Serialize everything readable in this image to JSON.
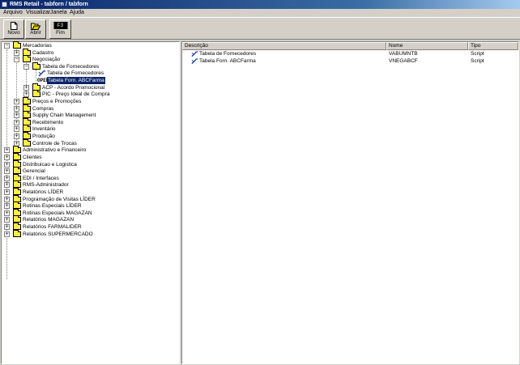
{
  "window": {
    "title": "RMS Retail - tabforn / tabforn"
  },
  "menu": [
    "Arquivo",
    "Visualizar",
    "Janela",
    "Ajuda"
  ],
  "toolbar": {
    "buttons": [
      {
        "label": "Novo",
        "icon": "new-document-icon"
      },
      {
        "label": "Abrir",
        "icon": "open-folder-icon"
      },
      {
        "label": "Fim",
        "icon": "exit-icon",
        "icon_text": "F3"
      }
    ]
  },
  "tree": {
    "nodes": [
      {
        "label": "Mercadorias",
        "expander": "-"
      },
      {
        "label": "Cadastro",
        "expander": "+"
      },
      {
        "label": "Negociação",
        "expander": "-"
      },
      {
        "label": "Tabela de Fornecedores",
        "expander": "-"
      },
      {
        "label": "Tabela de Fornecedores",
        "icon": "tool-icon"
      },
      {
        "label": "Tabela Forn. ABCFarma",
        "icon": "open-icon",
        "icon_text": "OPEN",
        "selected": true
      },
      {
        "label": "ACP - Acordo Promocional",
        "expander": "+"
      },
      {
        "label": "PIC - Preço Ideal de Compra",
        "expander": "+"
      },
      {
        "label": "Preços e Promoções",
        "expander": "+"
      },
      {
        "label": "Compras",
        "expander": "+"
      },
      {
        "label": "Supply Chain Management",
        "expander": "+"
      },
      {
        "label": "Recebimento",
        "expander": "+"
      },
      {
        "label": "Inventário",
        "expander": "+"
      },
      {
        "label": "Produção",
        "expander": "+"
      },
      {
        "label": "Controle de Trocas",
        "expander": "+"
      },
      {
        "label": "Administrativo e Financeiro",
        "expander": "+"
      },
      {
        "label": "Clientes",
        "expander": "+"
      },
      {
        "label": "Distribuicao e Logistica",
        "expander": "+"
      },
      {
        "label": "Gerencial",
        "expander": "+"
      },
      {
        "label": "EDI / Interfaces",
        "expander": "+"
      },
      {
        "label": "RMS-Administrador",
        "expander": "+"
      },
      {
        "label": "Relatórios LÍDER",
        "expander": "+"
      },
      {
        "label": "Programação de Visitas LÍDER",
        "expander": "+"
      },
      {
        "label": "Rotinas Especiais LÍDER",
        "expander": "+"
      },
      {
        "label": "Rotinas Especiais MAGAZAN",
        "expander": "+"
      },
      {
        "label": "Relatórios MAGAZAN",
        "expander": "+"
      },
      {
        "label": "Relatórios FARMALIDER",
        "expander": "+"
      },
      {
        "label": "Relatórios SUPERMERCADO",
        "expander": "+"
      }
    ]
  },
  "list": {
    "columns": [
      "Descrição",
      "Nome",
      "Tipo"
    ],
    "rows": [
      {
        "descricao": "Tabela de Fornecedores",
        "nome": "VABUMNTB",
        "tipo": "Script"
      },
      {
        "descricao": "Tabela Forn. ABCFarma",
        "nome": "VNEGABCF",
        "tipo": "Script"
      }
    ]
  },
  "colors": {
    "title_active": "#0a246a",
    "selection": "#0a246a",
    "folder": "#ffef40",
    "face": "#d4d0c8"
  }
}
